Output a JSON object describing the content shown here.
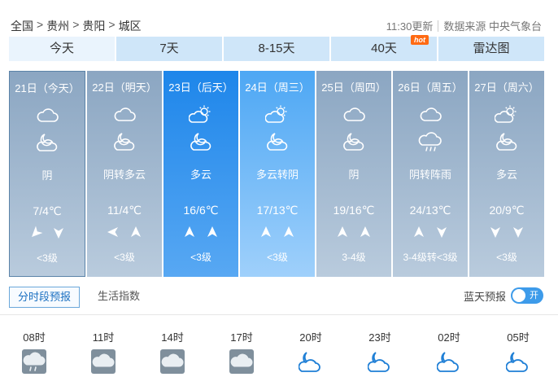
{
  "breadcrumb": {
    "items": [
      "全国",
      "贵州",
      "贵阳",
      "城区"
    ],
    "sep": ">"
  },
  "meta": {
    "updated": "11:30更新",
    "source": "数据来源 中央气象台"
  },
  "tabs": [
    {
      "label": "今天"
    },
    {
      "label": "7天"
    },
    {
      "label": "8-15天"
    },
    {
      "label": "40天",
      "badge": "hot"
    },
    {
      "label": "雷达图"
    }
  ],
  "days": [
    {
      "date": "21日（今天）",
      "icon_day": "cloudy",
      "icon_night": "partly-cloudy-night",
      "condition": "阴",
      "temp": "7/4℃",
      "wind1": "left-down",
      "wind2": "down",
      "level": "<3级"
    },
    {
      "date": "22日（明天）",
      "icon_day": "cloudy",
      "icon_night": "partly-cloudy-night",
      "condition": "阴转多云",
      "temp": "11/4℃",
      "wind1": "left",
      "wind2": "up",
      "level": "<3级"
    },
    {
      "date": "23日（后天）",
      "icon_day": "partly-cloudy-day",
      "icon_night": "partly-cloudy-night",
      "condition": "多云",
      "temp": "16/6℃",
      "wind1": "up",
      "wind2": "up",
      "level": "<3级"
    },
    {
      "date": "24日（周三）",
      "icon_day": "partly-cloudy-day",
      "icon_night": "partly-cloudy-night",
      "condition": "多云转阴",
      "temp": "17/13℃",
      "wind1": "up",
      "wind2": "up",
      "level": "<3级"
    },
    {
      "date": "25日（周四）",
      "icon_day": "cloudy",
      "icon_night": "partly-cloudy-night",
      "condition": "阴",
      "temp": "19/16℃",
      "wind1": "up",
      "wind2": "up",
      "level": "3-4级"
    },
    {
      "date": "26日（周五）",
      "icon_day": "cloudy",
      "icon_night": "shower",
      "condition": "阴转阵雨",
      "temp": "24/13℃",
      "wind1": "up",
      "wind2": "down",
      "level": "3-4级转<3级"
    },
    {
      "date": "27日（周六）",
      "icon_day": "partly-cloudy-day",
      "icon_night": "partly-cloudy-night",
      "condition": "多云",
      "temp": "20/9℃",
      "wind1": "down",
      "wind2": "down",
      "level": "<3级"
    }
  ],
  "subtabs": {
    "hourly": "分时段预报",
    "life": "生活指数"
  },
  "bluesky": {
    "label": "蓝天预报",
    "toggle": "开"
  },
  "hours": [
    {
      "time": "08时",
      "icon": "rain-cloud"
    },
    {
      "time": "11时",
      "icon": "cloudy"
    },
    {
      "time": "14时",
      "icon": "cloudy"
    },
    {
      "time": "17时",
      "icon": "cloudy"
    },
    {
      "time": "20时",
      "icon": "partly-cloudy-night"
    },
    {
      "time": "23时",
      "icon": "partly-cloudy-night"
    },
    {
      "time": "02时",
      "icon": "partly-cloudy-night"
    },
    {
      "time": "05时",
      "icon": "partly-cloudy-night"
    }
  ],
  "colors": {
    "accent": "#1e86ea",
    "tab_bg": "#cfe6f9",
    "hot_badge": "#ff6a13",
    "toggle_on": "#3d9bea"
  }
}
